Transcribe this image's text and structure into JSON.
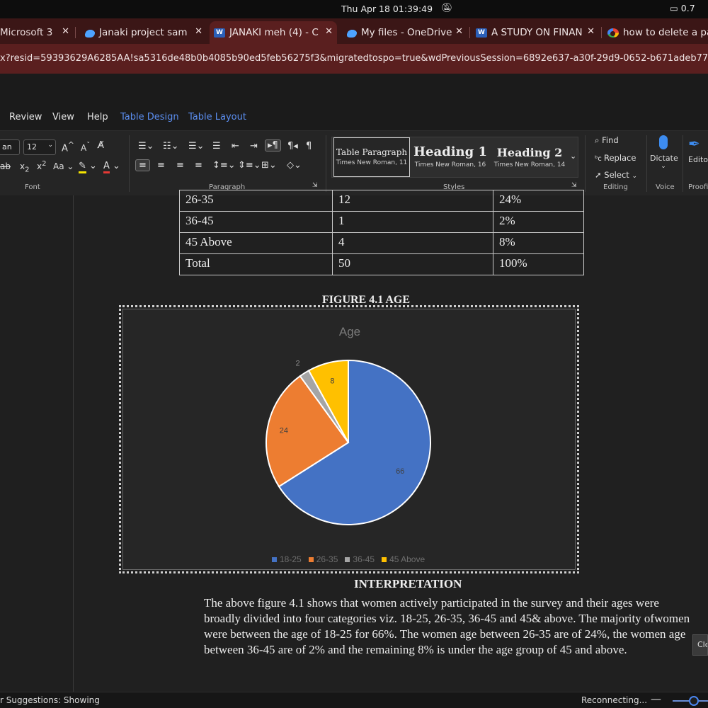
{
  "os_bar": {
    "clock": "Thu Apr 18  01:39:49",
    "battery": "0.7"
  },
  "browser": {
    "tabs": [
      {
        "label": "Microsoft 3",
        "icon": "microsoft-icon",
        "active": false
      },
      {
        "label": "Janaki project sam",
        "icon": "onedrive-icon",
        "active": false
      },
      {
        "label": "JANAKI meh (4) - C",
        "icon": "word-icon",
        "active": true
      },
      {
        "label": "My files - OneDrive",
        "icon": "onedrive-icon",
        "active": false
      },
      {
        "label": "A STUDY ON FINAN",
        "icon": "word-icon",
        "active": false
      },
      {
        "label": "how to delete a pa",
        "icon": "google-icon",
        "active": false
      }
    ],
    "url": "x?resid=59393629A6285AA!sa5316de48b0b4085b90ed5feb56275f3&migratedtospo=true&wdPreviousSession=6892e637-a30f-29d9-0652-b671adeb77c6"
  },
  "menu": {
    "review": "Review",
    "view": "View",
    "help": "Help",
    "table_design": "Table Design",
    "table_layout": "Table Layout"
  },
  "ribbon": {
    "font_name": "an",
    "font_size": "12",
    "font_label": "Font",
    "paragraph_label": "Paragraph",
    "styles_label": "Styles",
    "editing_label": "Editing",
    "voice_label": "Voice",
    "proofing_label": "Proofin",
    "styles": [
      {
        "name": "Table Paragraph",
        "font": "Times New Roman, 11"
      },
      {
        "name": "Heading 1",
        "font": "Times New Roman, 16"
      },
      {
        "name": "Heading 2",
        "font": "Times New Roman, 14"
      }
    ],
    "find": "Find",
    "replace": "Replace",
    "select": "Select",
    "dictate": "Dictate",
    "editor": "Edito"
  },
  "document": {
    "table_rows": [
      [
        "26-35",
        "12",
        "24%"
      ],
      [
        "36-45",
        "1",
        "2%"
      ],
      [
        "45 Above",
        "4",
        "8%"
      ],
      [
        "Total",
        "50",
        "100%"
      ]
    ],
    "figure_title": "FIGURE 4.1 AGE",
    "interpretation_title": "INTERPRETATION",
    "interpretation_text": "The above figure 4.1 shows that women actively participated in the survey and their ages were broadly divided into four categories viz. 18-25, 26-35, 36-45 and 45& above. The majority ofwomen were between the age of 18-25 for 66%. The women age between 26-35 are of 24%, the women age between 36-45 are of 2% and the remaining 8% is under the age group of 45 and above."
  },
  "chart_data": {
    "type": "pie",
    "title": "Age",
    "categories": [
      "18-25",
      "26-35",
      "36-45",
      "45 Above"
    ],
    "values": [
      66,
      24,
      2,
      8
    ],
    "colors": [
      "#4472c4",
      "#ed7d31",
      "#a5a5a5",
      "#ffc000"
    ],
    "legend": "bottom"
  },
  "status_bar": {
    "suggestions": "r Suggestions: Showing",
    "reconnecting": "Reconnecting...",
    "tooltip": "Clo"
  }
}
